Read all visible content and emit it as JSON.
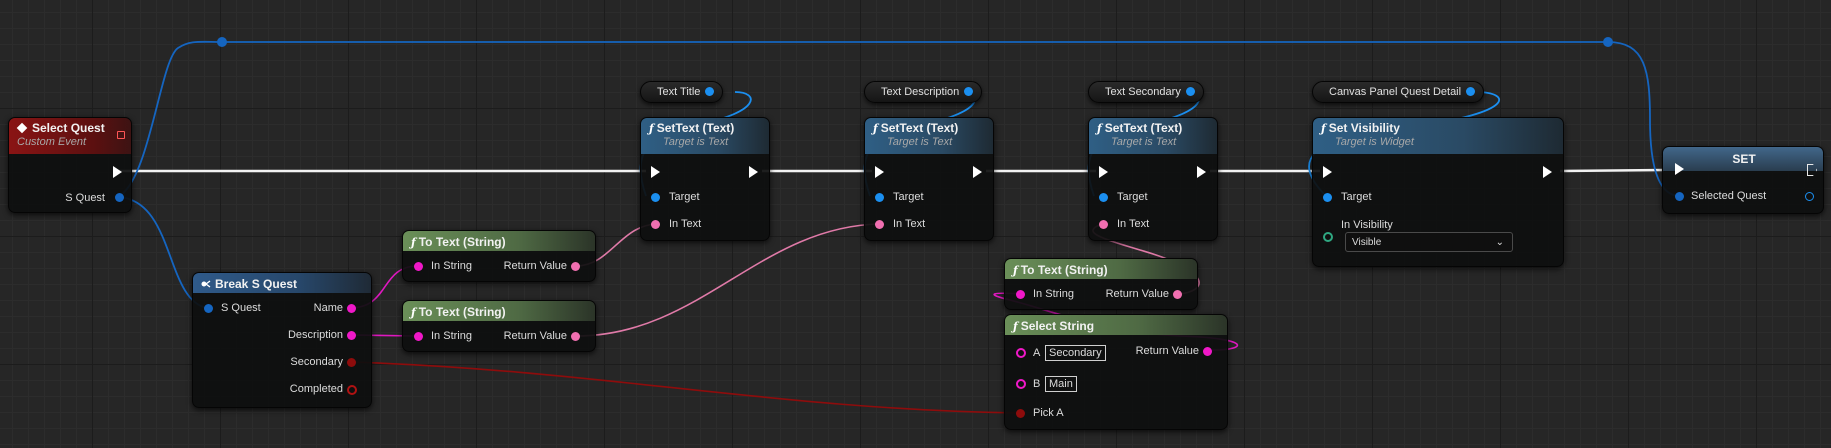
{
  "nodes": {
    "select_quest": {
      "title": "Select Quest",
      "subtitle": "Custom Event",
      "pin_s_quest": "S Quest"
    },
    "getter_text_title": {
      "label": "Text Title"
    },
    "getter_text_description": {
      "label": "Text Description"
    },
    "getter_text_secondary": {
      "label": "Text Secondary"
    },
    "getter_canvas_panel": {
      "label": "Canvas Panel Quest Detail"
    },
    "settext_1": {
      "fn": "ƒ",
      "title": "SetText (Text)",
      "subtitle": "Target is Text",
      "pin_target": "Target",
      "pin_in_text": "In Text"
    },
    "settext_2": {
      "fn": "ƒ",
      "title": "SetText (Text)",
      "subtitle": "Target is Text",
      "pin_target": "Target",
      "pin_in_text": "In Text"
    },
    "settext_3": {
      "fn": "ƒ",
      "title": "SetText (Text)",
      "subtitle": "Target is Text",
      "pin_target": "Target",
      "pin_in_text": "In Text"
    },
    "set_visibility": {
      "fn": "ƒ",
      "title": "Set Visibility",
      "subtitle": "Target is Widget",
      "pin_target": "Target",
      "pin_in_visibility": "In Visibility",
      "visibility_value": "Visible"
    },
    "set_node": {
      "title": "SET",
      "pin_selected_quest": "Selected Quest"
    },
    "break_s_quest": {
      "title": "Break S Quest",
      "pin_s_quest": "S Quest",
      "pin_name": "Name",
      "pin_description": "Description",
      "pin_secondary": "Secondary",
      "pin_completed": "Completed"
    },
    "to_text_1": {
      "fn": "ƒ",
      "title": "To Text (String)",
      "pin_in_string": "In String",
      "pin_return": "Return Value"
    },
    "to_text_2": {
      "fn": "ƒ",
      "title": "To Text (String)",
      "pin_in_string": "In String",
      "pin_return": "Return Value"
    },
    "to_text_3": {
      "fn": "ƒ",
      "title": "To Text (String)",
      "pin_in_string": "In String",
      "pin_return": "Return Value"
    },
    "select_string": {
      "fn": "ƒ",
      "title": "Select String",
      "pin_a": "A",
      "value_a": "Secondary",
      "pin_b": "B",
      "value_b": "Main",
      "pin_pick_a": "Pick A",
      "pin_return": "Return Value"
    }
  },
  "colors": {
    "exec_wire": "#f2f2f2",
    "object_wire": "#1565c0",
    "text_wire": "#e07aa8",
    "string_wire": "#e018c0",
    "bool_wire": "#8e0c0c"
  }
}
